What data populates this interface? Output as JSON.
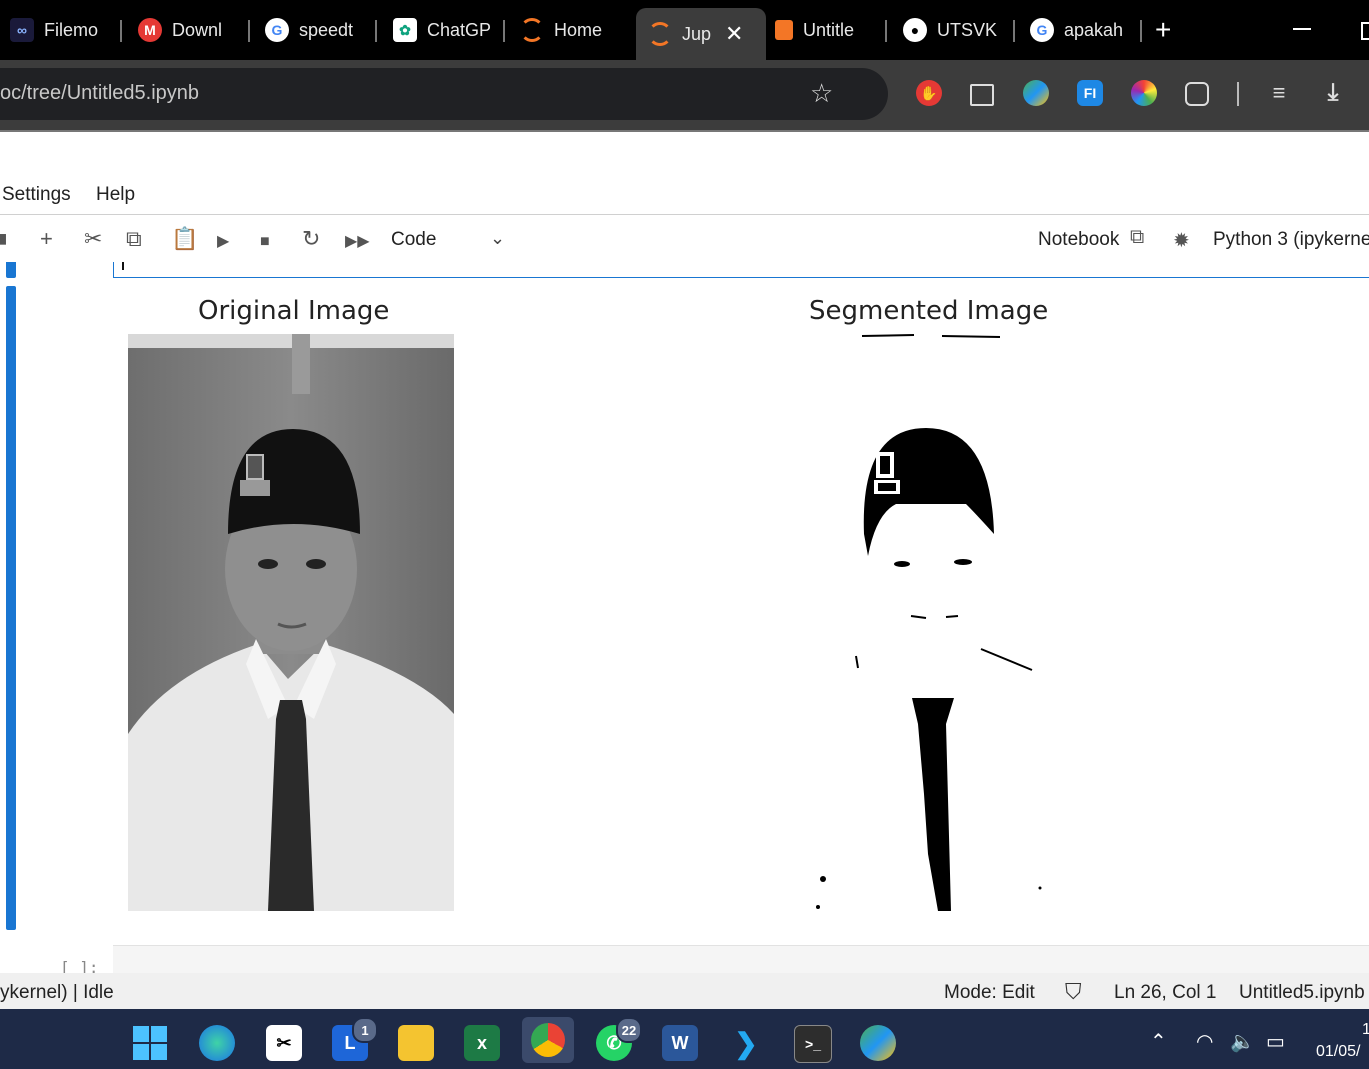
{
  "browser": {
    "tabs": [
      {
        "label": "Filemo",
        "icon": "filemoon-icon"
      },
      {
        "label": "Downl",
        "icon": "gmail-icon"
      },
      {
        "label": "speedt",
        "icon": "google-icon"
      },
      {
        "label": "ChatGP",
        "icon": "chatgpt-icon"
      },
      {
        "label": "Home",
        "icon": "jupyter-icon"
      },
      {
        "label": "Jup",
        "icon": "jupyter-icon",
        "active": true
      },
      {
        "label": "Untitle",
        "icon": "notebook-icon"
      },
      {
        "label": "UTSVK",
        "icon": "github-icon"
      },
      {
        "label": "apakah",
        "icon": "google-icon"
      }
    ],
    "url": "oc/tree/Untitled5.ipynb"
  },
  "jupyter": {
    "menu": [
      "Settings",
      "Help"
    ],
    "toolbar": {
      "cell_type": "Code",
      "notebook_label": "Notebook",
      "kernel_label": "Python 3 (ipykerne"
    },
    "output": {
      "left_title": "Original Image",
      "right_title": "Segmented Image"
    },
    "next_prompt": "[ ]:",
    "status": {
      "kernel_state": "ykernel) | Idle",
      "mode": "Mode: Edit",
      "position": "Ln 26, Col 1",
      "filename": "Untitled5.ipynb"
    }
  },
  "taskbar": {
    "badges": {
      "launcher": "1",
      "whatsapp": "22"
    },
    "clock_time": "1",
    "clock_date": "01/05/"
  }
}
